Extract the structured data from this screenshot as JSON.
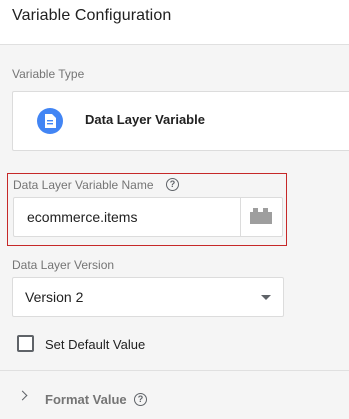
{
  "header": {
    "title": "Variable Configuration"
  },
  "variable_type": {
    "section_label": "Variable Type",
    "selected_name": "Data Layer Variable",
    "icon": "document-icon",
    "icon_color": "#4285f4"
  },
  "dlv_name": {
    "label": "Data Layer Variable Name",
    "value": "ecommerce.items",
    "help_icon": "help-icon",
    "insert_variable_icon": "variable-lego-icon"
  },
  "dlv_version": {
    "label": "Data Layer Version",
    "selected": "Version 2"
  },
  "default_value": {
    "label": "Set Default Value",
    "checked": false
  },
  "format_value": {
    "label": "Format Value",
    "expanded": false
  },
  "colors": {
    "highlight": "#c62828",
    "accent": "#4285f4"
  }
}
